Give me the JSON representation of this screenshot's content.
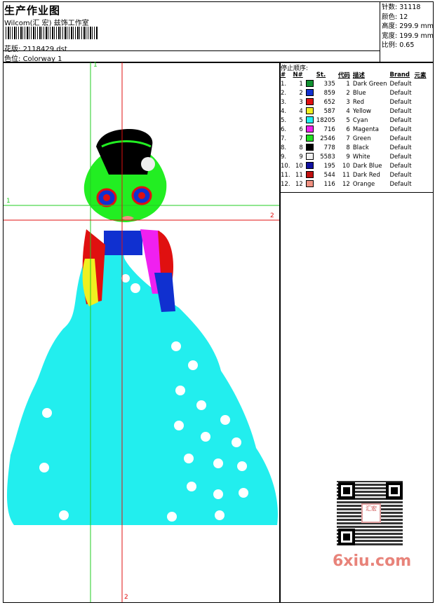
{
  "header": {
    "title": "生产作业图",
    "company": "Wilcom(汇 宏) 兹饰工作室",
    "design_label": "花版:",
    "design_value": "2118429.dst",
    "colorway_label": "色位:",
    "colorway_value": "Colorway 1"
  },
  "stats": [
    {
      "label": "针数:",
      "value": "31118"
    },
    {
      "label": "颜色:",
      "value": "12"
    },
    {
      "label": "高度:",
      "value": "299.9 mm"
    },
    {
      "label": "宽度:",
      "value": "199.9 mm"
    },
    {
      "label": "比例:",
      "value": "0.65"
    }
  ],
  "sequence": {
    "title": "停止顺序:",
    "headers": [
      "#",
      "N#",
      "",
      "St.",
      "代码",
      "描述",
      "Brand",
      "元素"
    ],
    "rows": [
      {
        "n": "1.",
        "nn": "1",
        "color": "#109030",
        "st": "335",
        "code": "1",
        "desc": "Dark Green",
        "brand": "Default"
      },
      {
        "n": "2.",
        "nn": "2",
        "color": "#1030d0",
        "st": "859",
        "code": "2",
        "desc": "Blue",
        "brand": "Default"
      },
      {
        "n": "3.",
        "nn": "3",
        "color": "#e01010",
        "st": "652",
        "code": "3",
        "desc": "Red",
        "brand": "Default"
      },
      {
        "n": "4.",
        "nn": "4",
        "color": "#f0f020",
        "st": "587",
        "code": "4",
        "desc": "Yellow",
        "brand": "Default"
      },
      {
        "n": "5.",
        "nn": "5",
        "color": "#20f0f0",
        "st": "18205",
        "code": "5",
        "desc": "Cyan",
        "brand": "Default"
      },
      {
        "n": "6.",
        "nn": "6",
        "color": "#f020f0",
        "st": "716",
        "code": "6",
        "desc": "Magenta",
        "brand": "Default"
      },
      {
        "n": "7.",
        "nn": "7",
        "color": "#20e020",
        "st": "2546",
        "code": "7",
        "desc": "Green",
        "brand": "Default"
      },
      {
        "n": "8.",
        "nn": "8",
        "color": "#000000",
        "st": "778",
        "code": "8",
        "desc": "Black",
        "brand": "Default"
      },
      {
        "n": "9.",
        "nn": "9",
        "color": "#f0f0f0",
        "st": "5583",
        "code": "9",
        "desc": "White",
        "brand": "Default"
      },
      {
        "n": "10.",
        "nn": "10",
        "color": "#1010a0",
        "st": "195",
        "code": "10",
        "desc": "Dark Blue",
        "brand": "Default"
      },
      {
        "n": "11.",
        "nn": "11",
        "color": "#c01010",
        "st": "544",
        "code": "11",
        "desc": "Dark Red",
        "brand": "Default"
      },
      {
        "n": "12.",
        "nn": "12",
        "color": "#f09080",
        "st": "116",
        "code": "12",
        "desc": "Orange",
        "brand": "Default"
      }
    ]
  },
  "guides": {
    "green_label_top": "1",
    "green_label_left": "1",
    "red_label_right": "2",
    "red_label_bottom": "2"
  },
  "qr": {
    "logo_text": "汇宏",
    "icon": "qr-code-icon"
  },
  "watermark": "6xiu.com"
}
